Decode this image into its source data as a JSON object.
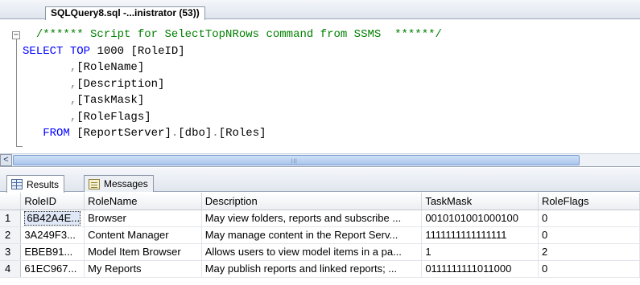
{
  "query_tab": {
    "title": "SQLQuery8.sql -...inistrator (53))"
  },
  "editor": {
    "comment": "/****** Script for SelectTopNRows command from SSMS  ******/",
    "kw_select": "SELECT",
    "kw_top": "TOP",
    "top_n": " 1000 ",
    "col1": "[RoleID]",
    "col2": "[RoleName]",
    "col3": "[Description]",
    "col4": "[TaskMask]",
    "col5": "[RoleFlags]",
    "comma": ",",
    "kw_from": "FROM",
    "db": "[ReportServer]",
    "schema": "[dbo]",
    "table": "[Roles]",
    "dot": "."
  },
  "scrollbar": {
    "left_arrow": "<"
  },
  "results_tabs": [
    {
      "label": "Results",
      "icon": "grid-icon"
    },
    {
      "label": "Messages",
      "icon": "messages-icon"
    }
  ],
  "grid": {
    "columns": [
      "RoleID",
      "RoleName",
      "Description",
      "TaskMask",
      "RoleFlags"
    ],
    "rows": [
      [
        "1",
        "6B42A4E...",
        "Browser",
        "May view folders, reports and subscribe ...",
        "0010101001000100",
        "0"
      ],
      [
        "2",
        "3A249F3...",
        "Content Manager",
        "May manage content in the Report Serv...",
        "1111111111111111",
        "0"
      ],
      [
        "3",
        "EBEB91...",
        "Model Item Browser",
        "Allows users to view model items in a pa...",
        "1",
        "2"
      ],
      [
        "4",
        "61EC967...",
        "My Reports",
        "May publish reports and linked reports; ...",
        "0111111111011000",
        "0"
      ]
    ]
  }
}
